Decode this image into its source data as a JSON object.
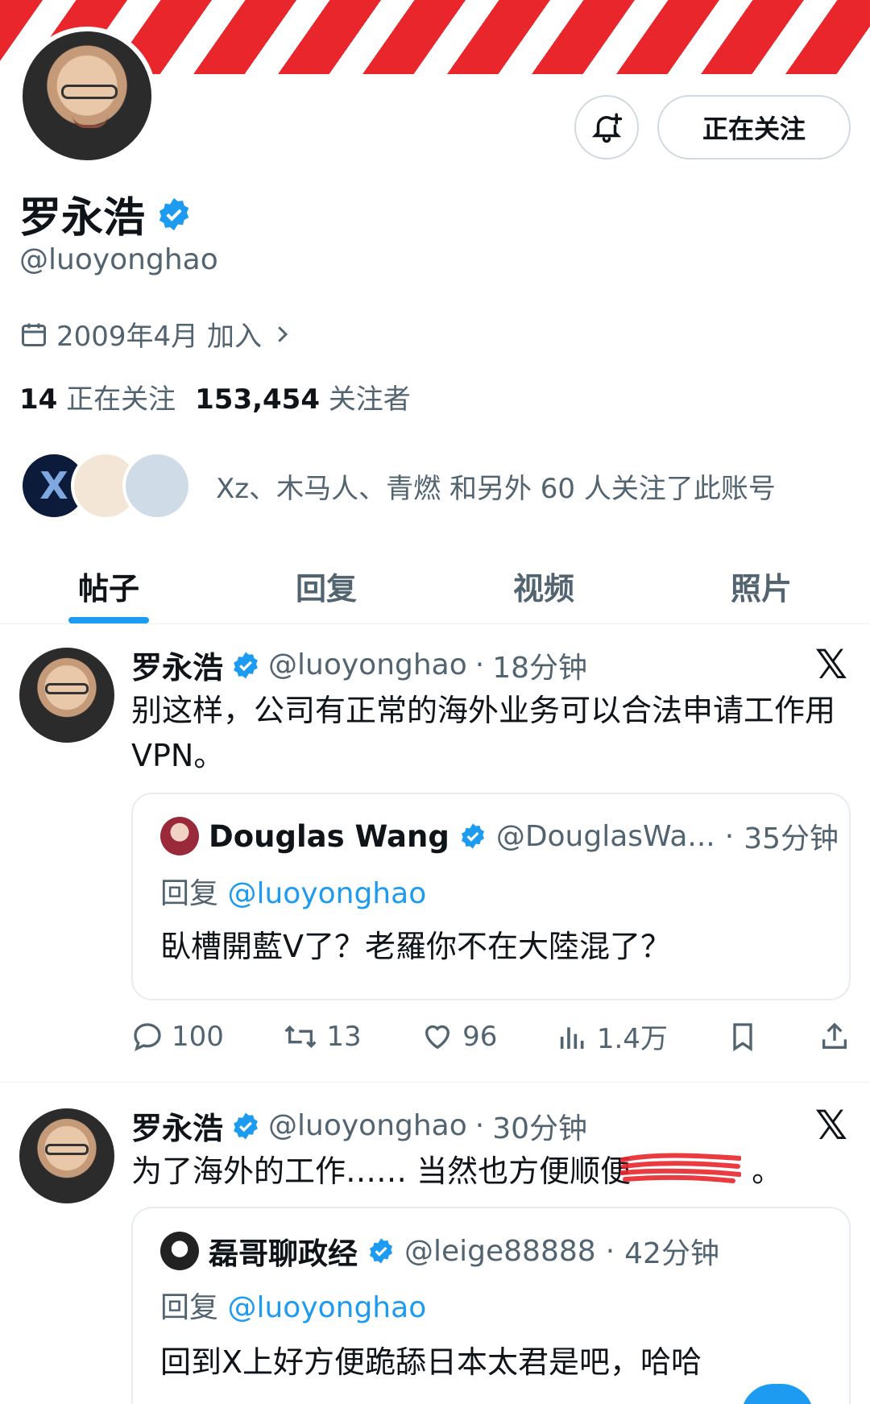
{
  "colors": {
    "accent": "#1d9bf0",
    "banner_red": "#e8262b",
    "text": "#0f1419",
    "muted": "#536471"
  },
  "profile": {
    "name": "罗永浩",
    "handle": "@luoyonghao",
    "joined": "2009年4月 加入",
    "following_count": "14",
    "following_label": "正在关注",
    "followers_count": "153,454",
    "followers_label": "关注者",
    "followed_by_text": "Xz、木马人、青燃 和另外 60 人关注了此账号",
    "follow_button": "正在关注"
  },
  "tabs": [
    {
      "label": "帖子",
      "active": true
    },
    {
      "label": "回复",
      "active": false
    },
    {
      "label": "视频",
      "active": false
    },
    {
      "label": "照片",
      "active": false
    }
  ],
  "posts": [
    {
      "name": "罗永浩",
      "handle": "@luoyonghao",
      "time": "18分钟",
      "text": "别这样，公司有正常的海外业务可以合法申请工作用 VPN。",
      "quote": {
        "name": "Douglas Wang",
        "handle": "@DouglasWa...",
        "time": "35分钟",
        "reply_prefix": "回复",
        "reply_to": "@luoyonghao",
        "text": "臥槽開藍V了？老羅你不在大陸混了？"
      },
      "stats": {
        "replies": "100",
        "retweets": "13",
        "likes": "96",
        "views": "1.4万"
      }
    },
    {
      "name": "罗永浩",
      "handle": "@luoyonghao",
      "time": "30分钟",
      "text_visible": "为了海外的工作…… 当然也方便顺便",
      "text_end": "。",
      "quote": {
        "name": "磊哥聊政经",
        "handle": "@leige88888",
        "time": "42分钟",
        "reply_prefix": "回复",
        "reply_to": "@luoyonghao",
        "text": "回到X上好方便跪舔日本太君是吧，哈哈"
      }
    }
  ],
  "icons": [
    "bell-plus-icon",
    "verified-badge-icon",
    "calendar-icon",
    "chevron-right-icon",
    "x-logo-icon",
    "reply-icon",
    "retweet-icon",
    "like-icon",
    "views-icon",
    "bookmark-icon",
    "share-icon"
  ]
}
